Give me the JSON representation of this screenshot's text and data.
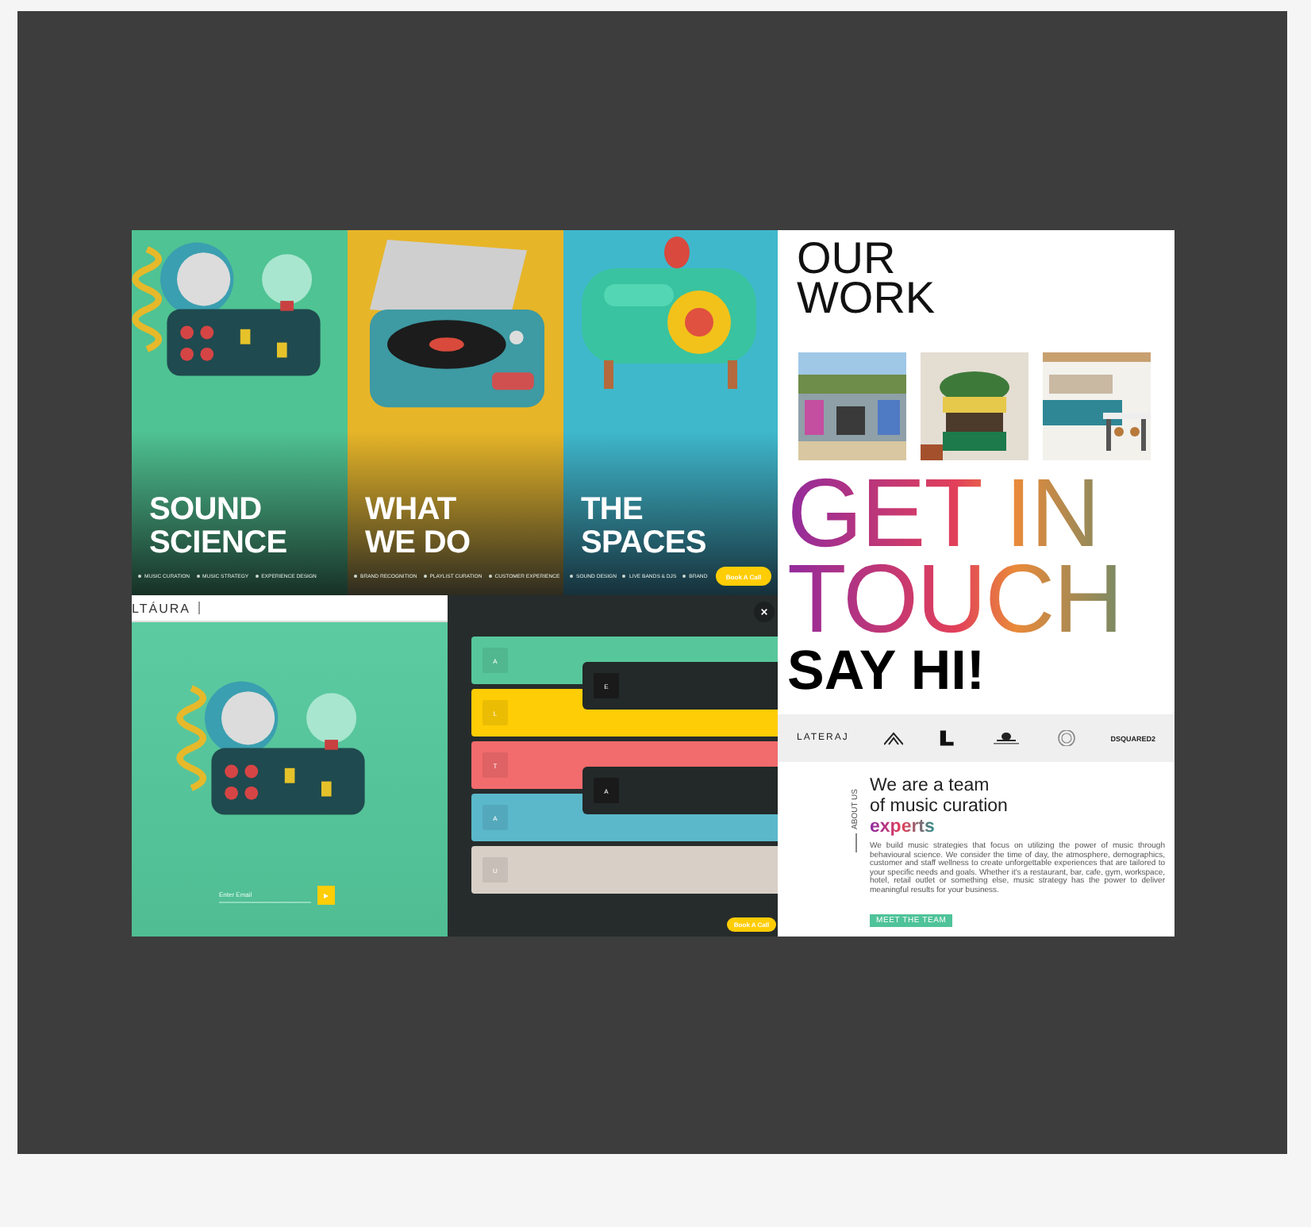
{
  "panels": [
    {
      "title": [
        "SOUND",
        "SCIENCE"
      ],
      "tags": [
        "MUSIC CURATION",
        "MUSIC STRATEGY",
        "EXPERIENCE DESIGN"
      ]
    },
    {
      "title": [
        "WHAT",
        "WE DO"
      ],
      "tags": [
        "BRAND RECOGNITION",
        "PLAYLIST CURATION",
        "CUSTOMER EXPERIENCE"
      ]
    },
    {
      "title": [
        "THE",
        "SPACES"
      ],
      "tags": [
        "SOUND DESIGN",
        "LIVE BANDS & DJS",
        "BRAND"
      ],
      "button": "Book A Call"
    }
  ],
  "signup": {
    "logo": "LTÁURA",
    "email": {
      "placeholder": "Enter Email"
    }
  },
  "menu": {
    "items": [
      {
        "letter": "A",
        "color": "#57c79b"
      },
      {
        "letter": "L",
        "color": "#ffcd05"
      },
      {
        "letter": "T",
        "color": "#f26b6d"
      },
      {
        "letter": "A",
        "color": "#5bb8cb"
      },
      {
        "letter": "U",
        "color": "#d8d0c7"
      }
    ],
    "tabs": [
      {
        "letter": "E"
      },
      {
        "letter": "A"
      }
    ],
    "button": "Book A Call"
  },
  "site": {
    "work_title": [
      "OUR",
      "WORK"
    ],
    "contact_title": [
      "GET IN",
      "TOUCH"
    ],
    "greeting": "SAY HI!",
    "logos": [
      "LATERAJ",
      "DSQUARED2"
    ],
    "section_label": "ABOUT US",
    "heading": [
      "We are a team",
      "of music curation"
    ],
    "highlight": "experts",
    "body": "We build music strategies that focus on utilizing the power of music through behavioural science. We consider the time of day, the atmosphere, demographics, customer and staff wellness to create unforgettable experiences that are tailored to your specific needs and goals. Whether it's a restaurant, bar, cafe, gym, workspace, hotel, retail outlet or something else, music strategy has the power to deliver meaningful results for your business.",
    "button": "MEET THE TEAM"
  }
}
